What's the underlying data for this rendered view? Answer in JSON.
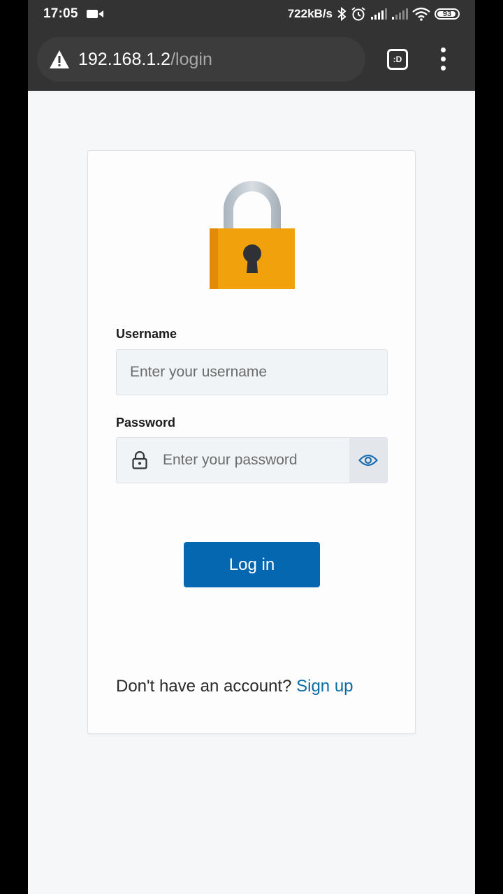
{
  "status_bar": {
    "time": "17:05",
    "net_speed": "722kB/s",
    "battery_level": "93",
    "icons": [
      "video-record-icon",
      "bluetooth-icon",
      "alarm-icon",
      "signal-1-icon",
      "signal-2-icon",
      "wifi-icon",
      "battery-icon"
    ]
  },
  "browser": {
    "url_host": "192.168.1.2",
    "url_path": "/login",
    "tabs_label": ":D",
    "icons": [
      "warning-icon",
      "tabs-icon",
      "more-vert-icon"
    ]
  },
  "login_form": {
    "username_label": "Username",
    "username_placeholder": "Enter your username",
    "password_label": "Password",
    "password_placeholder": "Enter your password",
    "login_button": "Log in",
    "signup_prompt": "Don't have an account?",
    "signup_link": "Sign up"
  },
  "colors": {
    "primary": "#0467b0",
    "link": "#0a6aa6",
    "padlock_body": "#f0a10b",
    "browser_chrome": "#333333"
  }
}
